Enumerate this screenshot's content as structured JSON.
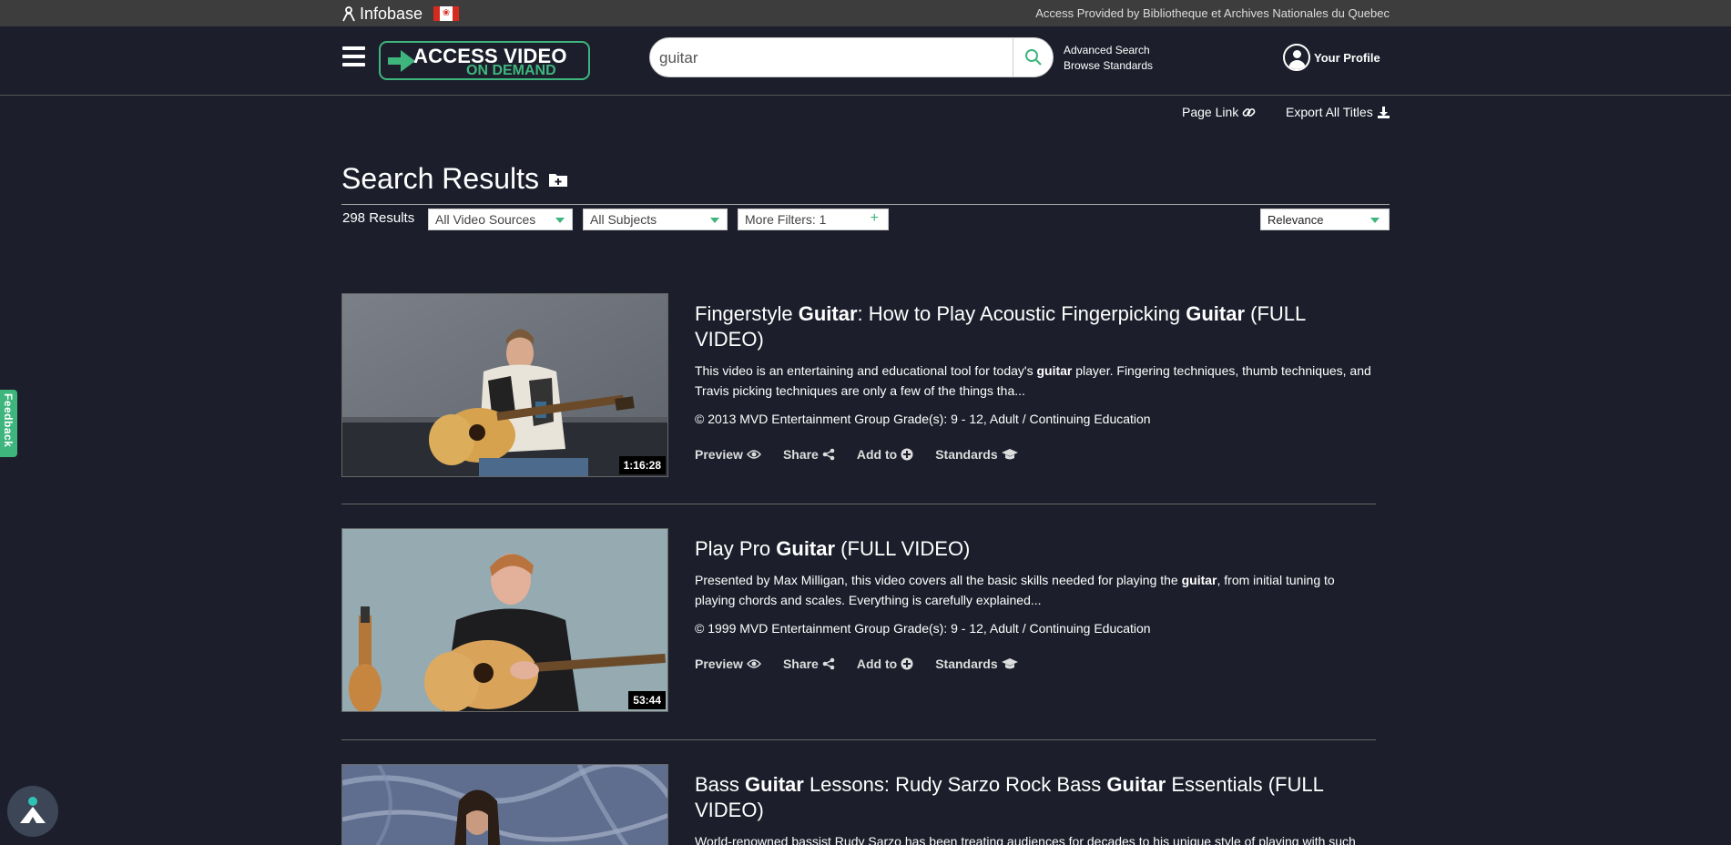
{
  "topbar": {
    "brand": "Infobase",
    "access_provided": "Access Provided by Bibliotheque et Archives Nationales du Quebec"
  },
  "header": {
    "logo_line1": "ACCESS VIDEO",
    "logo_line2": "ON DEMAND",
    "search_value": "guitar",
    "advanced_search": "Advanced Search",
    "browse_standards": "Browse Standards",
    "profile": "Your Profile"
  },
  "toolbar": {
    "page_link": "Page Link",
    "export_all": "Export All Titles"
  },
  "results_header": {
    "title": "Search Results",
    "count": "298 Results",
    "video_sources": "All Video Sources",
    "subjects": "All Subjects",
    "more_filters": "More Filters: 1",
    "sort": "Relevance"
  },
  "results": [
    {
      "title_html_parts": [
        "Fingerstyle ",
        "Guitar",
        ": How to Play Acoustic Fingerpicking ",
        "Guitar",
        " (FULL VIDEO)"
      ],
      "desc_parts": [
        "This video is an entertaining and educational tool for today's ",
        "guitar",
        " player. Fingering techniques, thumb techniques, and Travis picking techniques are only a few of the things tha..."
      ],
      "meta": "© 2013 MVD Entertainment Group Grade(s): 9 - 12, Adult / Continuing Education",
      "duration": "1:16:28"
    },
    {
      "title_html_parts": [
        "Play Pro ",
        "Guitar",
        " (FULL VIDEO)"
      ],
      "desc_parts": [
        "Presented by Max Milligan, this video covers all the basic skills needed for playing the ",
        "guitar",
        ", from initial tuning to playing chords and scales. Everything is carefully explained..."
      ],
      "meta": "© 1999 MVD Entertainment Group Grade(s): 9 - 12, Adult / Continuing Education",
      "duration": "53:44"
    },
    {
      "title_html_parts": [
        "Bass ",
        "Guitar",
        " Lessons: Rudy Sarzo Rock Bass ",
        "Guitar",
        " Essentials (FULL VIDEO)"
      ],
      "desc_parts": [
        "World-renowned bassist Rudy Sarzo has been treating audiences for decades to his unique style of playing with such",
        "",
        ""
      ]
    }
  ],
  "actions": {
    "preview": "Preview",
    "share": "Share",
    "add_to": "Add to",
    "standards": "Standards"
  },
  "feedback": "Feedback",
  "colors": {
    "background": "#1c1f2b",
    "topbar": "#3d3d3d",
    "accent": "#3fb57e"
  }
}
